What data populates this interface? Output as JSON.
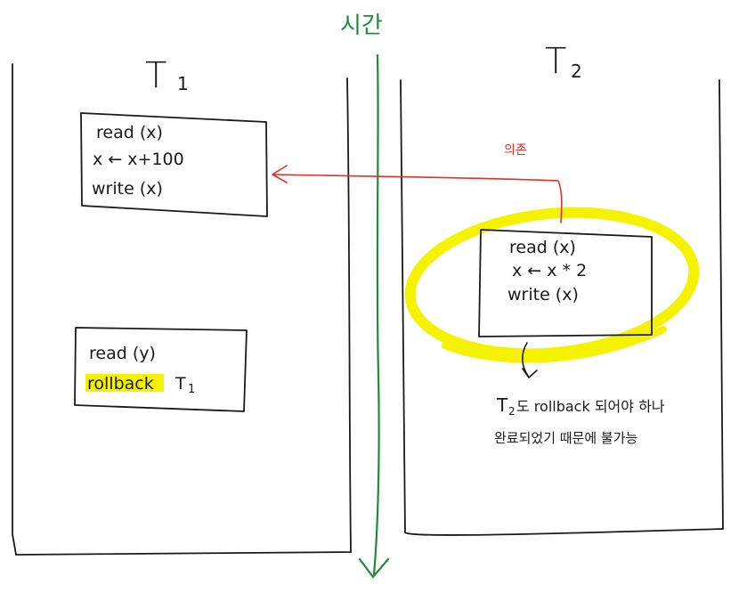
{
  "time_label": "시간",
  "t1": {
    "title": "T",
    "title_sub": "1",
    "box1": {
      "line1": "read (x)",
      "line2": "x ← x+100",
      "line3": "write (x)"
    },
    "box2": {
      "line1": "read (y)",
      "rollback_word": "rollback",
      "rollback_target": "T",
      "rollback_target_sub": "1"
    }
  },
  "t2": {
    "title": "T",
    "title_sub": "2",
    "box": {
      "line1": "read (x)",
      "line2": "x ← x * 2",
      "line3": "write (x)"
    }
  },
  "dependency_label": "의존",
  "note": {
    "line1_prefix": "T",
    "line1_sub": "2",
    "line1_rest": "도 rollback 되어야 하나",
    "line2": "완료되었기 때문에 불가능"
  },
  "colors": {
    "ink": "#1a1a1a",
    "timeline": "#1f8b3a",
    "dependency": "#e0302c",
    "highlight": "#f5f200"
  }
}
